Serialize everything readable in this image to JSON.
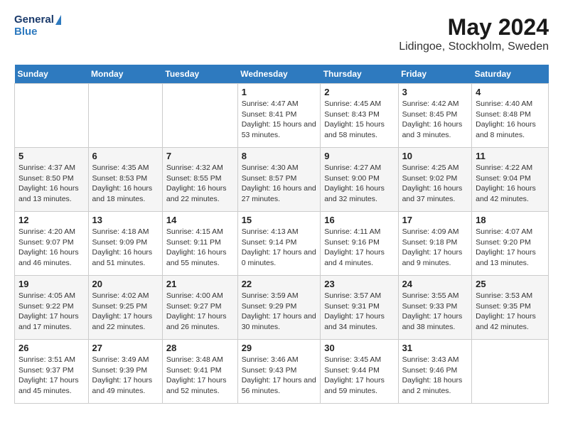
{
  "header": {
    "logo_general": "General",
    "logo_blue": "Blue",
    "title": "May 2024",
    "subtitle": "Lidingoe, Stockholm, Sweden"
  },
  "weekdays": [
    "Sunday",
    "Monday",
    "Tuesday",
    "Wednesday",
    "Thursday",
    "Friday",
    "Saturday"
  ],
  "weeks": [
    [
      {
        "day": "",
        "sunrise": "",
        "sunset": "",
        "daylight": ""
      },
      {
        "day": "",
        "sunrise": "",
        "sunset": "",
        "daylight": ""
      },
      {
        "day": "",
        "sunrise": "",
        "sunset": "",
        "daylight": ""
      },
      {
        "day": "1",
        "sunrise": "Sunrise: 4:47 AM",
        "sunset": "Sunset: 8:41 PM",
        "daylight": "Daylight: 15 hours and 53 minutes."
      },
      {
        "day": "2",
        "sunrise": "Sunrise: 4:45 AM",
        "sunset": "Sunset: 8:43 PM",
        "daylight": "Daylight: 15 hours and 58 minutes."
      },
      {
        "day": "3",
        "sunrise": "Sunrise: 4:42 AM",
        "sunset": "Sunset: 8:45 PM",
        "daylight": "Daylight: 16 hours and 3 minutes."
      },
      {
        "day": "4",
        "sunrise": "Sunrise: 4:40 AM",
        "sunset": "Sunset: 8:48 PM",
        "daylight": "Daylight: 16 hours and 8 minutes."
      }
    ],
    [
      {
        "day": "5",
        "sunrise": "Sunrise: 4:37 AM",
        "sunset": "Sunset: 8:50 PM",
        "daylight": "Daylight: 16 hours and 13 minutes."
      },
      {
        "day": "6",
        "sunrise": "Sunrise: 4:35 AM",
        "sunset": "Sunset: 8:53 PM",
        "daylight": "Daylight: 16 hours and 18 minutes."
      },
      {
        "day": "7",
        "sunrise": "Sunrise: 4:32 AM",
        "sunset": "Sunset: 8:55 PM",
        "daylight": "Daylight: 16 hours and 22 minutes."
      },
      {
        "day": "8",
        "sunrise": "Sunrise: 4:30 AM",
        "sunset": "Sunset: 8:57 PM",
        "daylight": "Daylight: 16 hours and 27 minutes."
      },
      {
        "day": "9",
        "sunrise": "Sunrise: 4:27 AM",
        "sunset": "Sunset: 9:00 PM",
        "daylight": "Daylight: 16 hours and 32 minutes."
      },
      {
        "day": "10",
        "sunrise": "Sunrise: 4:25 AM",
        "sunset": "Sunset: 9:02 PM",
        "daylight": "Daylight: 16 hours and 37 minutes."
      },
      {
        "day": "11",
        "sunrise": "Sunrise: 4:22 AM",
        "sunset": "Sunset: 9:04 PM",
        "daylight": "Daylight: 16 hours and 42 minutes."
      }
    ],
    [
      {
        "day": "12",
        "sunrise": "Sunrise: 4:20 AM",
        "sunset": "Sunset: 9:07 PM",
        "daylight": "Daylight: 16 hours and 46 minutes."
      },
      {
        "day": "13",
        "sunrise": "Sunrise: 4:18 AM",
        "sunset": "Sunset: 9:09 PM",
        "daylight": "Daylight: 16 hours and 51 minutes."
      },
      {
        "day": "14",
        "sunrise": "Sunrise: 4:15 AM",
        "sunset": "Sunset: 9:11 PM",
        "daylight": "Daylight: 16 hours and 55 minutes."
      },
      {
        "day": "15",
        "sunrise": "Sunrise: 4:13 AM",
        "sunset": "Sunset: 9:14 PM",
        "daylight": "Daylight: 17 hours and 0 minutes."
      },
      {
        "day": "16",
        "sunrise": "Sunrise: 4:11 AM",
        "sunset": "Sunset: 9:16 PM",
        "daylight": "Daylight: 17 hours and 4 minutes."
      },
      {
        "day": "17",
        "sunrise": "Sunrise: 4:09 AM",
        "sunset": "Sunset: 9:18 PM",
        "daylight": "Daylight: 17 hours and 9 minutes."
      },
      {
        "day": "18",
        "sunrise": "Sunrise: 4:07 AM",
        "sunset": "Sunset: 9:20 PM",
        "daylight": "Daylight: 17 hours and 13 minutes."
      }
    ],
    [
      {
        "day": "19",
        "sunrise": "Sunrise: 4:05 AM",
        "sunset": "Sunset: 9:22 PM",
        "daylight": "Daylight: 17 hours and 17 minutes."
      },
      {
        "day": "20",
        "sunrise": "Sunrise: 4:02 AM",
        "sunset": "Sunset: 9:25 PM",
        "daylight": "Daylight: 17 hours and 22 minutes."
      },
      {
        "day": "21",
        "sunrise": "Sunrise: 4:00 AM",
        "sunset": "Sunset: 9:27 PM",
        "daylight": "Daylight: 17 hours and 26 minutes."
      },
      {
        "day": "22",
        "sunrise": "Sunrise: 3:59 AM",
        "sunset": "Sunset: 9:29 PM",
        "daylight": "Daylight: 17 hours and 30 minutes."
      },
      {
        "day": "23",
        "sunrise": "Sunrise: 3:57 AM",
        "sunset": "Sunset: 9:31 PM",
        "daylight": "Daylight: 17 hours and 34 minutes."
      },
      {
        "day": "24",
        "sunrise": "Sunrise: 3:55 AM",
        "sunset": "Sunset: 9:33 PM",
        "daylight": "Daylight: 17 hours and 38 minutes."
      },
      {
        "day": "25",
        "sunrise": "Sunrise: 3:53 AM",
        "sunset": "Sunset: 9:35 PM",
        "daylight": "Daylight: 17 hours and 42 minutes."
      }
    ],
    [
      {
        "day": "26",
        "sunrise": "Sunrise: 3:51 AM",
        "sunset": "Sunset: 9:37 PM",
        "daylight": "Daylight: 17 hours and 45 minutes."
      },
      {
        "day": "27",
        "sunrise": "Sunrise: 3:49 AM",
        "sunset": "Sunset: 9:39 PM",
        "daylight": "Daylight: 17 hours and 49 minutes."
      },
      {
        "day": "28",
        "sunrise": "Sunrise: 3:48 AM",
        "sunset": "Sunset: 9:41 PM",
        "daylight": "Daylight: 17 hours and 52 minutes."
      },
      {
        "day": "29",
        "sunrise": "Sunrise: 3:46 AM",
        "sunset": "Sunset: 9:43 PM",
        "daylight": "Daylight: 17 hours and 56 minutes."
      },
      {
        "day": "30",
        "sunrise": "Sunrise: 3:45 AM",
        "sunset": "Sunset: 9:44 PM",
        "daylight": "Daylight: 17 hours and 59 minutes."
      },
      {
        "day": "31",
        "sunrise": "Sunrise: 3:43 AM",
        "sunset": "Sunset: 9:46 PM",
        "daylight": "Daylight: 18 hours and 2 minutes."
      },
      {
        "day": "",
        "sunrise": "",
        "sunset": "",
        "daylight": ""
      }
    ]
  ]
}
